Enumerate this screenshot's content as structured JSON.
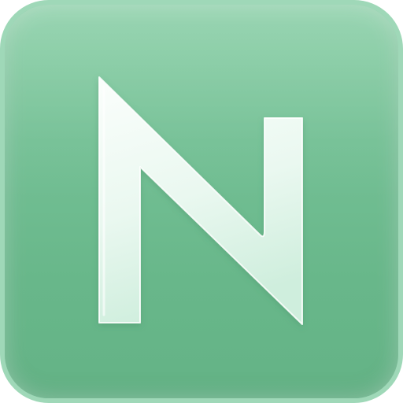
{
  "app_icon": {
    "glyph": "N",
    "colors": {
      "tile_top": "#8ed1aa",
      "tile_bottom": "#64b386",
      "tile_border": "#9fd8b8",
      "glyph_light": "#fbfefc",
      "glyph_dark": "#cfeedd"
    }
  }
}
